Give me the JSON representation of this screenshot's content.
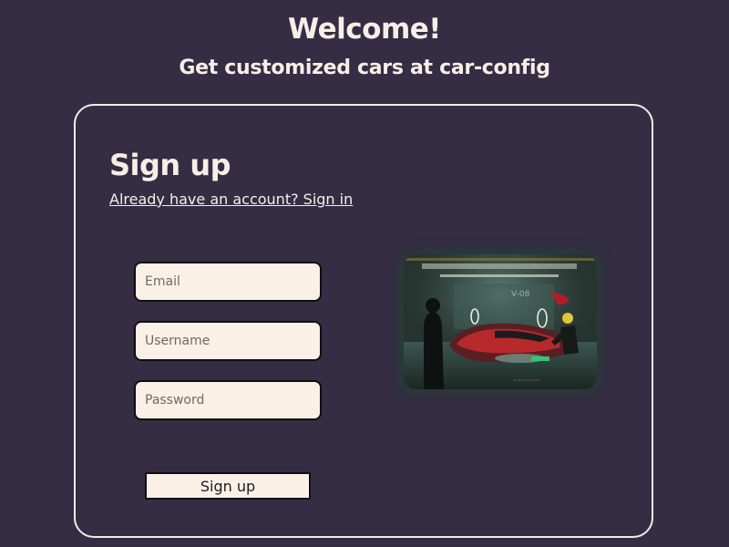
{
  "header": {
    "welcome": "Welcome!",
    "tagline": "Get customized cars at car-config"
  },
  "signup_form": {
    "title": "Sign up",
    "signin_link": "Already have an account? Sign in",
    "email_placeholder": "Email",
    "username_placeholder": "Username",
    "password_placeholder": "Password",
    "submit_label": "Sign up"
  },
  "colors": {
    "background": "#342d44",
    "text": "#f7efe6",
    "input_background": "#faf0e6",
    "input_border": "#0f0f12"
  }
}
